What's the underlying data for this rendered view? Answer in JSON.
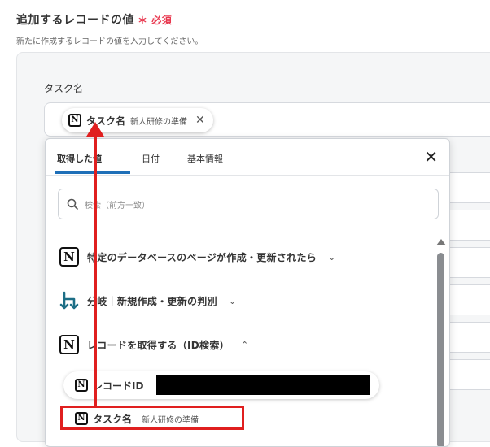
{
  "section": {
    "title": "追加するレコードの値",
    "required_mark": "＊",
    "required_label": "必須",
    "description": "新たに作成するレコードの値を入力してください。"
  },
  "field": {
    "label": "タスク名",
    "chip_name": "タスク名",
    "chip_value": "新人研修の準備",
    "chip_remove": "✕"
  },
  "popup": {
    "tabs": [
      {
        "label": "取得した値",
        "active": true
      },
      {
        "label": "日付",
        "active": false
      },
      {
        "label": "基本情報",
        "active": false
      }
    ],
    "close": "✕",
    "search_placeholder": "検索（前方一致）",
    "groups": [
      {
        "label": "特定のデータベースのページが作成・更新されたら",
        "icon": "notion-icon",
        "chevron": "⌄"
      },
      {
        "label": "分岐｜新規作成・更新の判別",
        "icon": "branch-icon",
        "chevron": "⌄"
      },
      {
        "label": "レコードを取得する（ID検索）",
        "icon": "notion-icon",
        "chevron": "⌃"
      }
    ],
    "items": [
      {
        "name": "レコードID",
        "value": ""
      },
      {
        "name": "タスク名",
        "value": "新人研修の準備"
      }
    ]
  },
  "colors": {
    "accent": "#1e6fb8",
    "required": "#e8384f",
    "annotation": "#e01f1f",
    "branch_icon": "#1c6e86"
  }
}
